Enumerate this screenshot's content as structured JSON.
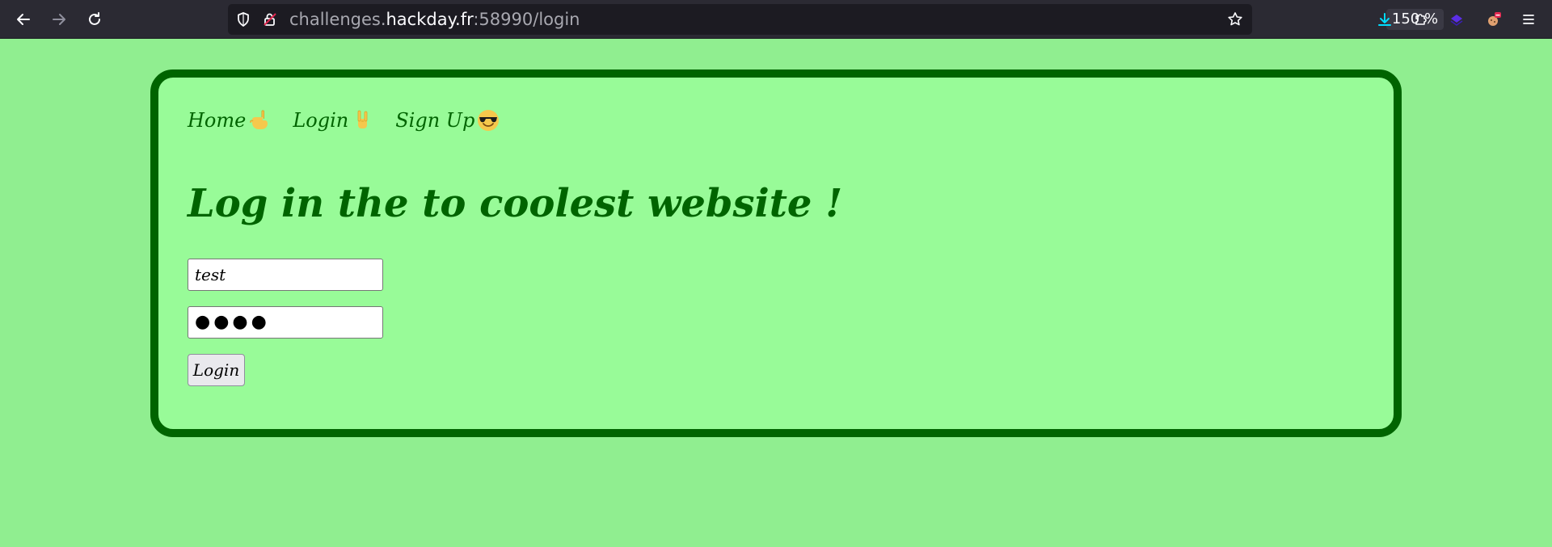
{
  "browser": {
    "url_scheme_host_prefix": "challenges.",
    "url_host": "hackday.fr",
    "url_rest": ":58990/login",
    "zoom": "150 %"
  },
  "nav": {
    "items": [
      {
        "label": "Home",
        "icon": "call-me-hand-icon"
      },
      {
        "label": "Login",
        "icon": "rock-hand-icon"
      },
      {
        "label": "Sign Up",
        "icon": "sunglasses-face-icon"
      }
    ]
  },
  "page": {
    "heading": "Log in the to coolest website !"
  },
  "form": {
    "username_value": "test",
    "password_value": "●●●●",
    "login_label": "Login"
  },
  "colors": {
    "background": "#90ee90",
    "card_background": "#98fb98",
    "card_border": "#006400",
    "text": "#006400"
  }
}
